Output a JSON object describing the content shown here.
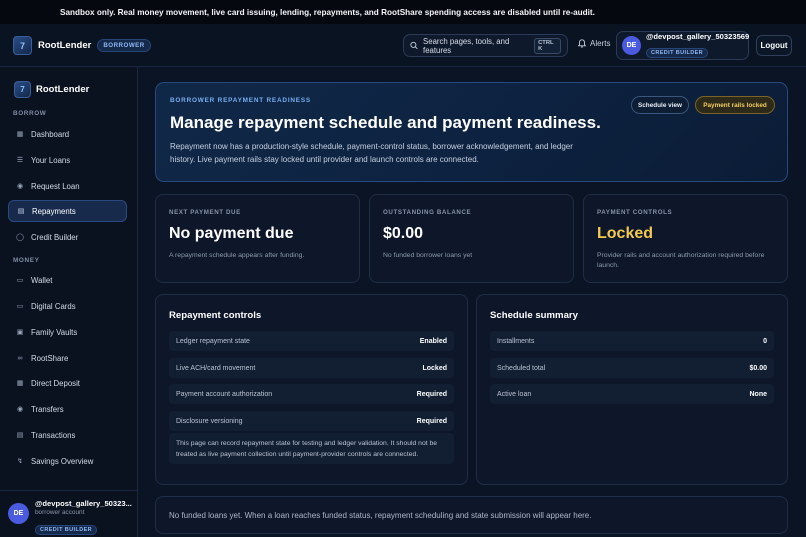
{
  "banner": {
    "text": "Sandbox only. Real money movement, live card issuing, lending, repayments, and RootShare spending access are disabled until re-audit."
  },
  "header": {
    "logo_glyph": "7",
    "brand": "RootLender",
    "role": "BORROWER",
    "search_label": "Search pages, tools, and features",
    "search_shortcut": "CTRL K",
    "alerts_label": "Alerts",
    "user": {
      "initials": "DE",
      "handle": "@devpost_gallery_50323569",
      "badge": "CREDIT BUILDER"
    },
    "logout_label": "Logout"
  },
  "sidebar": {
    "brand": "RootLender",
    "sections": [
      {
        "title": "BORROW",
        "items": [
          {
            "label": "Dashboard",
            "icon": "dashboard-icon",
            "active": false
          },
          {
            "label": "Your Loans",
            "icon": "loans-icon",
            "active": false
          },
          {
            "label": "Request Loan",
            "icon": "dollar-icon",
            "active": false
          },
          {
            "label": "Repayments",
            "icon": "receipt-icon",
            "active": true
          },
          {
            "label": "Credit Builder",
            "icon": "shield-icon",
            "active": false
          }
        ]
      },
      {
        "title": "MONEY",
        "items": [
          {
            "label": "Wallet",
            "icon": "wallet-icon",
            "active": false
          },
          {
            "label": "Digital Cards",
            "icon": "card-icon",
            "active": false
          },
          {
            "label": "Family Vaults",
            "icon": "vault-icon",
            "active": false
          },
          {
            "label": "RootShare",
            "icon": "share-icon",
            "active": false
          },
          {
            "label": "Direct Deposit",
            "icon": "building-icon",
            "active": false
          },
          {
            "label": "Transfers",
            "icon": "transfer-icon",
            "active": false
          },
          {
            "label": "Transactions",
            "icon": "list-icon",
            "active": false
          },
          {
            "label": "Savings Overview",
            "icon": "savings-icon",
            "active": false
          }
        ]
      }
    ],
    "user": {
      "initials": "DE",
      "name": "@devpost_gallery_50323...",
      "sub": "borrower account",
      "badge": "CREDIT BUILDER"
    }
  },
  "hero": {
    "eyebrow": "BORROWER REPAYMENT READINESS",
    "title": "Manage repayment schedule and payment readiness.",
    "body": "Repayment now has a production-style schedule, payment-control status, borrower acknowledgement, and ledger history. Live payment rails stay locked until provider and launch controls are connected.",
    "schedule_button": "Schedule view",
    "locked_badge": "Payment rails locked"
  },
  "stats": [
    {
      "label": "NEXT PAYMENT DUE",
      "value": "No payment due",
      "sub": "A repayment schedule appears after funding.",
      "highlight": false
    },
    {
      "label": "OUTSTANDING BALANCE",
      "value": "$0.00",
      "sub": "No funded borrower loans yet",
      "highlight": false
    },
    {
      "label": "PAYMENT CONTROLS",
      "value": "Locked",
      "sub": "Provider rails and account authorization required before launch.",
      "highlight": true
    }
  ],
  "repayment_controls": {
    "title": "Repayment controls",
    "rows": [
      {
        "label": "Ledger repayment state",
        "value": "Enabled"
      },
      {
        "label": "Live ACH/card movement",
        "value": "Locked"
      },
      {
        "label": "Payment account authorization",
        "value": "Required"
      },
      {
        "label": "Disclosure versioning",
        "value": "Required"
      }
    ],
    "note": "This page can record repayment state for testing and ledger validation. It should not be treated as live payment collection until payment-provider controls are connected."
  },
  "schedule_summary": {
    "title": "Schedule summary",
    "rows": [
      {
        "label": "Installments",
        "value": "0"
      },
      {
        "label": "Scheduled total",
        "value": "$0.00"
      },
      {
        "label": "Active loan",
        "value": "None"
      }
    ]
  },
  "empty_state": "No funded loans yet. When a loan reaches funded status, repayment scheduling and state submission will appear here.",
  "colors": {
    "accent": "#4b5be0",
    "locked": "#f4c94f",
    "background": "#0b1424"
  }
}
